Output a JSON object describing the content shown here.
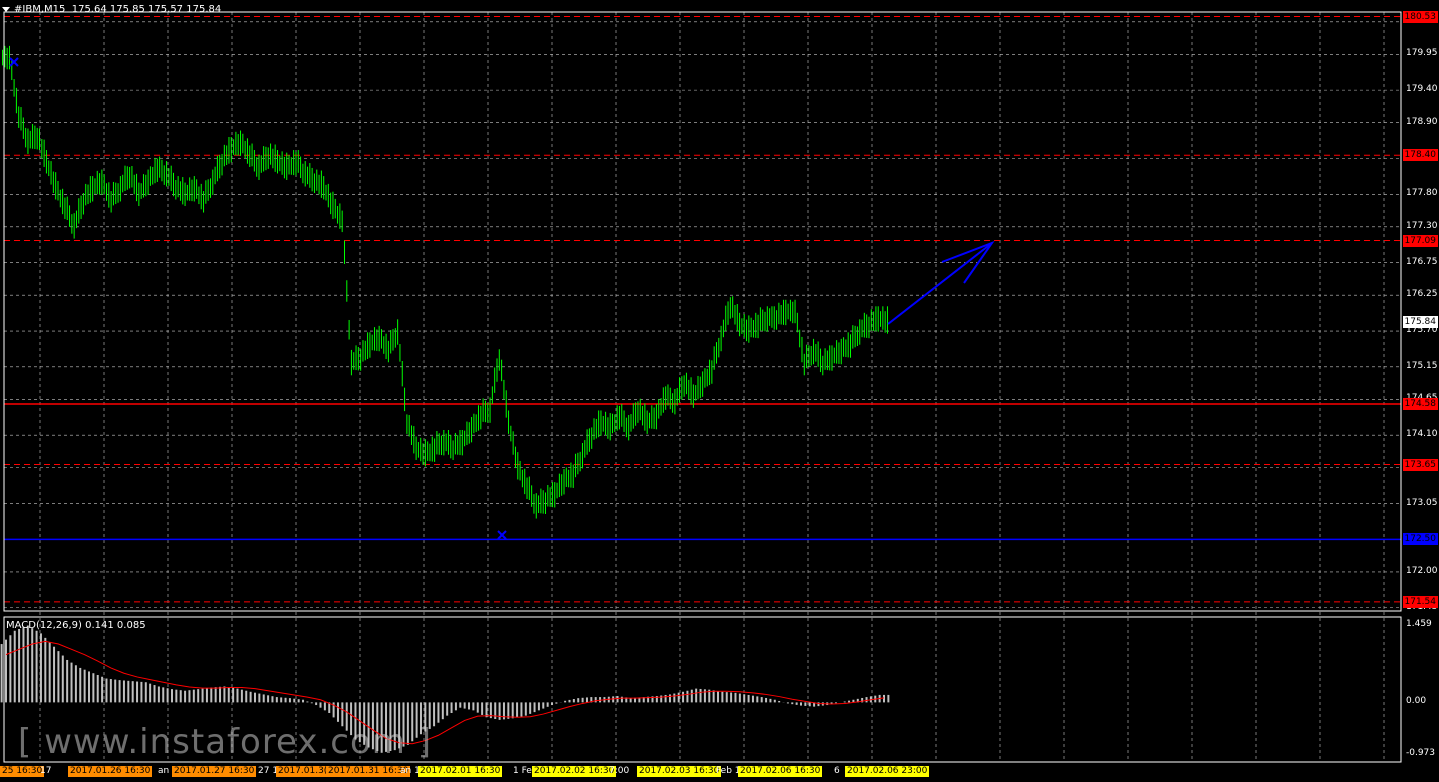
{
  "header": {
    "symbol_label": "#IBM,M15",
    "ohlc": "175.64 175.85 175.57 175.84"
  },
  "price_axis": {
    "ticks": [
      "180.45",
      "179.95",
      "179.40",
      "178.90",
      "178.35",
      "177.80",
      "177.30",
      "176.75",
      "176.25",
      "175.70",
      "175.15",
      "174.65",
      "174.10",
      "173.60",
      "173.05",
      "172.50",
      "172.00",
      "171.45"
    ]
  },
  "levels": [
    {
      "label": "180.53",
      "price": 180.53,
      "color": "#ff0000",
      "style": "dashed",
      "tag_bg": "#ff0000"
    },
    {
      "label": "178.40",
      "price": 178.4,
      "color": "#ff0000",
      "style": "dashed",
      "tag_bg": "#ff0000"
    },
    {
      "label": "177.09",
      "price": 177.09,
      "color": "#ff0000",
      "style": "dashed",
      "tag_bg": "#ff0000"
    },
    {
      "label": "174.58",
      "price": 174.58,
      "color": "#ff0000",
      "style": "solid",
      "tag_bg": "#ff0000"
    },
    {
      "label": "173.65",
      "price": 173.65,
      "color": "#ff0000",
      "style": "dashed",
      "tag_bg": "#ff0000"
    },
    {
      "label": "172.50",
      "price": 172.5,
      "color": "#0000ff",
      "style": "solid",
      "tag_bg": "#0000ff"
    },
    {
      "label": "171.54",
      "price": 171.54,
      "color": "#ff0000",
      "style": "dashed",
      "tag_bg": "#ff0000"
    }
  ],
  "current_price": {
    "label": "175.84",
    "price": 175.84
  },
  "macd": {
    "title": "MACD(12,26,9) 0.141 0.085",
    "axis": [
      "1.459",
      "0.00",
      "-0.973"
    ],
    "max": 1.459,
    "min": -0.973
  },
  "time_axis": [
    {
      "text": "25 16:30",
      "highlight": true,
      "bg": "#ff8c00"
    },
    {
      "text": "17",
      "highlight": false
    },
    {
      "text": "2017.01.26 16:30",
      "highlight": true,
      "bg": "#ff8c00"
    },
    {
      "text": "an 18",
      "highlight": false
    },
    {
      "text": "2017.01.27 16:30",
      "highlight": true,
      "bg": "#ff8c00"
    },
    {
      "text": "27 1",
      "highlight": false
    },
    {
      "text": "2017.01.3(",
      "highlight": true,
      "bg": "#ff8c00"
    },
    {
      "text": "2017.01.31 16:30",
      "highlight": true,
      "bg": "#ff8c00"
    },
    {
      "text": "an 18",
      "highlight": false
    },
    {
      "text": "2017.02.01 16:30",
      "highlight": true,
      "bg": "#ffff00"
    },
    {
      "text": "1 Fe",
      "highlight": false
    },
    {
      "text": "2017.02.02 16:30",
      "highlight": true,
      "bg": "#ffff00"
    },
    {
      "text": "7:00",
      "highlight": false
    },
    {
      "text": "2017.02.03 16:30",
      "highlight": true,
      "bg": "#ffff00"
    },
    {
      "text": "Feb 1",
      "highlight": false
    },
    {
      "text": "2017.02.06 16:30",
      "highlight": true,
      "bg": "#ffff00"
    },
    {
      "text": "6",
      "highlight": false
    },
    {
      "text": "2017.02.06 23:00",
      "highlight": true,
      "bg": "#ffff00"
    }
  ],
  "watermark": "[ www.instaforex.com ]",
  "colors": {
    "candle": "#00ff00",
    "grid": "#c8c8c8",
    "macd_hist": "#c0c0c0",
    "signal": "#ff0000",
    "arrow": "#0000ff",
    "marker": "#0000ff"
  },
  "price_series": [
    179.9,
    179.0,
    178.6,
    178.7,
    178.3,
    177.9,
    177.6,
    177.3,
    177.7,
    177.9,
    178.0,
    177.7,
    177.9,
    178.1,
    177.8,
    178.0,
    178.2,
    178.1,
    177.9,
    177.8,
    177.9,
    177.7,
    178.0,
    178.3,
    178.5,
    178.6,
    178.4,
    178.2,
    178.4,
    178.3,
    178.2,
    178.3,
    178.1,
    178.0,
    177.9,
    177.6,
    177.4,
    175.2,
    175.3,
    175.5,
    175.6,
    175.4,
    175.7,
    174.3,
    173.9,
    173.8,
    173.9,
    174.0,
    173.9,
    174.0,
    174.2,
    174.4,
    174.5,
    175.3,
    174.3,
    173.6,
    173.3,
    173.0,
    173.1,
    173.2,
    173.4,
    173.5,
    173.8,
    174.1,
    174.3,
    174.2,
    174.4,
    174.2,
    174.5,
    174.3,
    174.4,
    174.7,
    174.6,
    174.9,
    174.7,
    174.9,
    175.1,
    175.6,
    176.1,
    175.8,
    175.7,
    175.8,
    175.9,
    175.9,
    176.0,
    176.0,
    175.2,
    175.4,
    175.2,
    175.3,
    175.4,
    175.5,
    175.7,
    175.8,
    175.9,
    175.84
  ],
  "macd_series": [
    1.1,
    1.35,
    1.45,
    1.3,
    1.05,
    0.8,
    0.65,
    0.55,
    0.45,
    0.42,
    0.4,
    0.38,
    0.3,
    0.25,
    0.22,
    0.25,
    0.28,
    0.3,
    0.26,
    0.2,
    0.15,
    0.1,
    0.08,
    0.05,
    -0.05,
    -0.2,
    -0.45,
    -0.7,
    -0.85,
    -0.95,
    -0.9,
    -0.8,
    -0.6,
    -0.45,
    -0.25,
    -0.1,
    -0.15,
    -0.28,
    -0.33,
    -0.3,
    -0.25,
    -0.15,
    -0.05,
    0.03,
    0.08,
    0.1,
    0.1,
    0.12,
    0.08,
    0.1,
    0.12,
    0.15,
    0.2,
    0.26,
    0.24,
    0.2,
    0.18,
    0.14,
    0.1,
    0.05,
    -0.02,
    -0.06,
    -0.08,
    -0.05,
    0.0,
    0.05,
    0.1,
    0.141
  ],
  "signal_series": [
    0.9,
    1.0,
    1.1,
    1.15,
    1.1,
    1.0,
    0.9,
    0.78,
    0.65,
    0.55,
    0.48,
    0.43,
    0.38,
    0.33,
    0.29,
    0.27,
    0.27,
    0.28,
    0.28,
    0.26,
    0.22,
    0.18,
    0.14,
    0.1,
    0.05,
    -0.05,
    -0.18,
    -0.35,
    -0.52,
    -0.68,
    -0.76,
    -0.78,
    -0.72,
    -0.62,
    -0.48,
    -0.34,
    -0.26,
    -0.25,
    -0.27,
    -0.28,
    -0.27,
    -0.22,
    -0.15,
    -0.08,
    -0.02,
    0.03,
    0.06,
    0.08,
    0.08,
    0.09,
    0.1,
    0.12,
    0.15,
    0.19,
    0.21,
    0.21,
    0.2,
    0.18,
    0.15,
    0.11,
    0.06,
    0.02,
    -0.02,
    -0.03,
    -0.02,
    0.01,
    0.05,
    0.085
  ]
}
